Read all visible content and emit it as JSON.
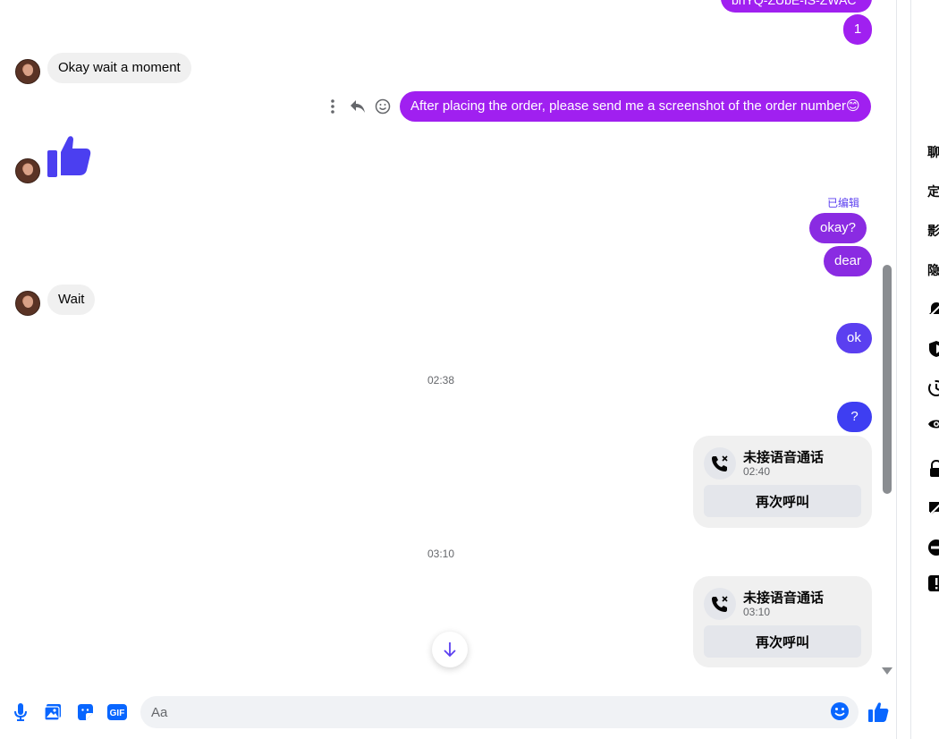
{
  "colors": {
    "accent": "#0866ff",
    "out_purple": "#a020f0",
    "out_violet": "#8a2be2",
    "out_indigo": "#5b3ff0",
    "out_blue": "#3e3ef2",
    "in_bubble": "#f0f0f0"
  },
  "messages": {
    "partial_top": "bnYQ-ZUbE-IS-ZWAC",
    "m1": "1",
    "m2": "Okay wait a moment",
    "m3": "After placing the order, please send me a screenshot of the order number😊",
    "edited": "已编辑",
    "m4": "okay?",
    "m5": "dear",
    "m6": "Wait",
    "m7": "ok",
    "m8": "?"
  },
  "timestamps": {
    "t1": "02:38",
    "t2": "03:10"
  },
  "calls": [
    {
      "title": "未接语音通话",
      "time": "02:40",
      "button": "再次呼叫"
    },
    {
      "title": "未接语音通话",
      "time": "03:10",
      "button": "再次呼叫"
    }
  ],
  "composer": {
    "placeholder": "Aa"
  },
  "side_panel": {
    "items": [
      "聊",
      "定",
      "影",
      "隐"
    ]
  },
  "icons": [
    "more-icon",
    "reply-icon",
    "react-icon",
    "thumbs-up-icon",
    "missed-call-icon",
    "arrow-down-icon",
    "mic-icon",
    "image-icon",
    "sticker-icon",
    "gif-icon",
    "emoji-icon",
    "like-icon",
    "bell-off-icon",
    "shield-icon",
    "timer-icon",
    "eye-icon",
    "lock-icon",
    "chat-off-icon",
    "block-icon",
    "report-icon"
  ]
}
